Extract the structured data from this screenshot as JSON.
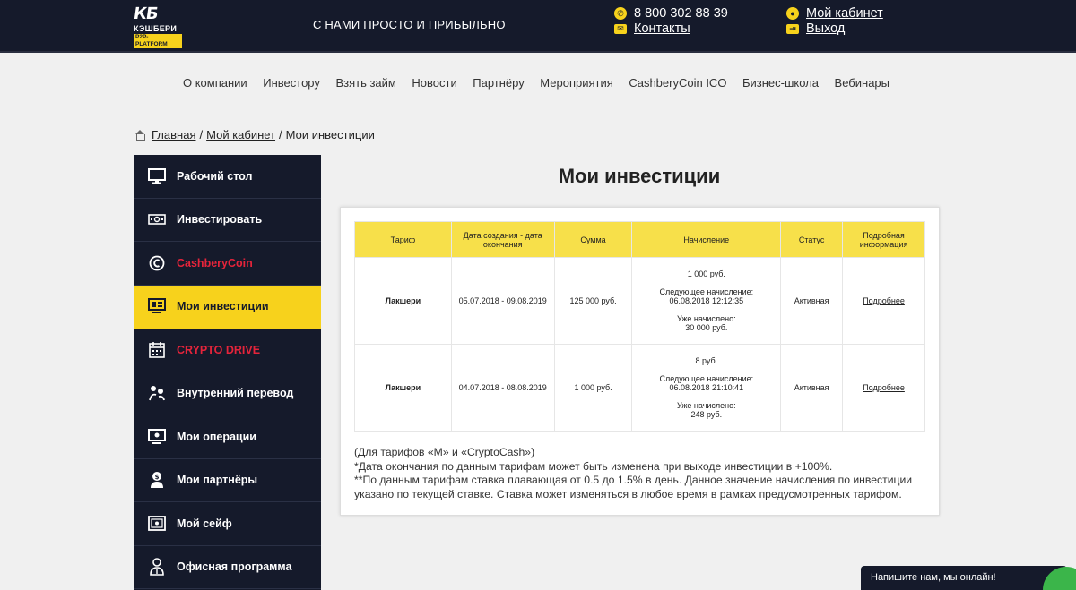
{
  "header": {
    "logo_mark": "КБ",
    "logo_name": "КЭШБЕРИ",
    "logo_sub": "P2P-PLATFORM",
    "slogan": "С НАМИ ПРОСТО И ПРИБЫЛЬНО",
    "phone": "8 800 302 88 39",
    "contacts": "Контакты",
    "cabinet": "Мой кабинет",
    "logout": "Выход"
  },
  "nav": [
    "О компании",
    "Инвестору",
    "Взять займ",
    "Новости",
    "Партнёру",
    "Мероприятия",
    "CashberyCoin ICO",
    "Бизнес-школа",
    "Вебинары"
  ],
  "breadcrumb": {
    "home": "Главная",
    "cabinet": "Мой кабинет",
    "current": "Мои инвестиции"
  },
  "sidebar": [
    {
      "label": "Рабочий стол",
      "icon": "monitor-icon"
    },
    {
      "label": "Инвестировать",
      "icon": "cash-icon"
    },
    {
      "label": "CashberyCoin",
      "icon": "coin-icon"
    },
    {
      "label": "Мои инвестиции",
      "icon": "investments-icon"
    },
    {
      "label": "CRYPTO DRIVE",
      "icon": "calendar-icon"
    },
    {
      "label": "Внутренний перевод",
      "icon": "transfer-icon"
    },
    {
      "label": "Мои операции",
      "icon": "operations-icon"
    },
    {
      "label": "Мои партнёры",
      "icon": "partners-icon"
    },
    {
      "label": "Мой сейф",
      "icon": "safe-icon"
    },
    {
      "label": "Офисная программа",
      "icon": "office-icon"
    }
  ],
  "page": {
    "title": "Мои инвестиции"
  },
  "table": {
    "headers": [
      "Тариф",
      "Дата создания - дата окончания",
      "Сумма",
      "Начисление",
      "Статус",
      "Подробная информация"
    ],
    "rows": [
      {
        "tariff": "Лакшери",
        "dates": "05.07.2018 - 09.08.2019",
        "sum": "125 000 руб.",
        "accrual": "1 000 руб.",
        "next_label": "Следующее начисление:",
        "next_date": "06.08.2018 12:12:35",
        "accrued_label": "Уже начислено:",
        "accrued": "30 000 руб.",
        "status": "Активная",
        "details": "Подробнее"
      },
      {
        "tariff": "Лакшери",
        "dates": "04.07.2018 - 08.08.2019",
        "sum": "1 000 руб.",
        "accrual": "8 руб.",
        "next_label": "Следующее начисление:",
        "next_date": "06.08.2018 21:10:41",
        "accrued_label": "Уже начислено:",
        "accrued": "248 руб.",
        "status": "Активная",
        "details": "Подробнее"
      }
    ]
  },
  "notes": [
    "(Для тарифов «M» и «CryptoCash»)",
    "*Дата окончания по данным тарифам может быть изменена при выходе инвестиции в +100%.",
    "**По данным тарифам ставка плавающая от 0.5 до 1.5% в день. Данное значение начисления по инвестиции указано по текущей ставке. Ставка может изменяться в любое время в рамках предусмотренных тарифом."
  ],
  "chat": {
    "label": "Напишите нам, мы онлайн!"
  },
  "colors": {
    "dark": "#151a2b",
    "accent": "#f7d21c",
    "table_header": "#f7e04a",
    "red": "#e5243b",
    "chat_green": "#3bb54a"
  }
}
